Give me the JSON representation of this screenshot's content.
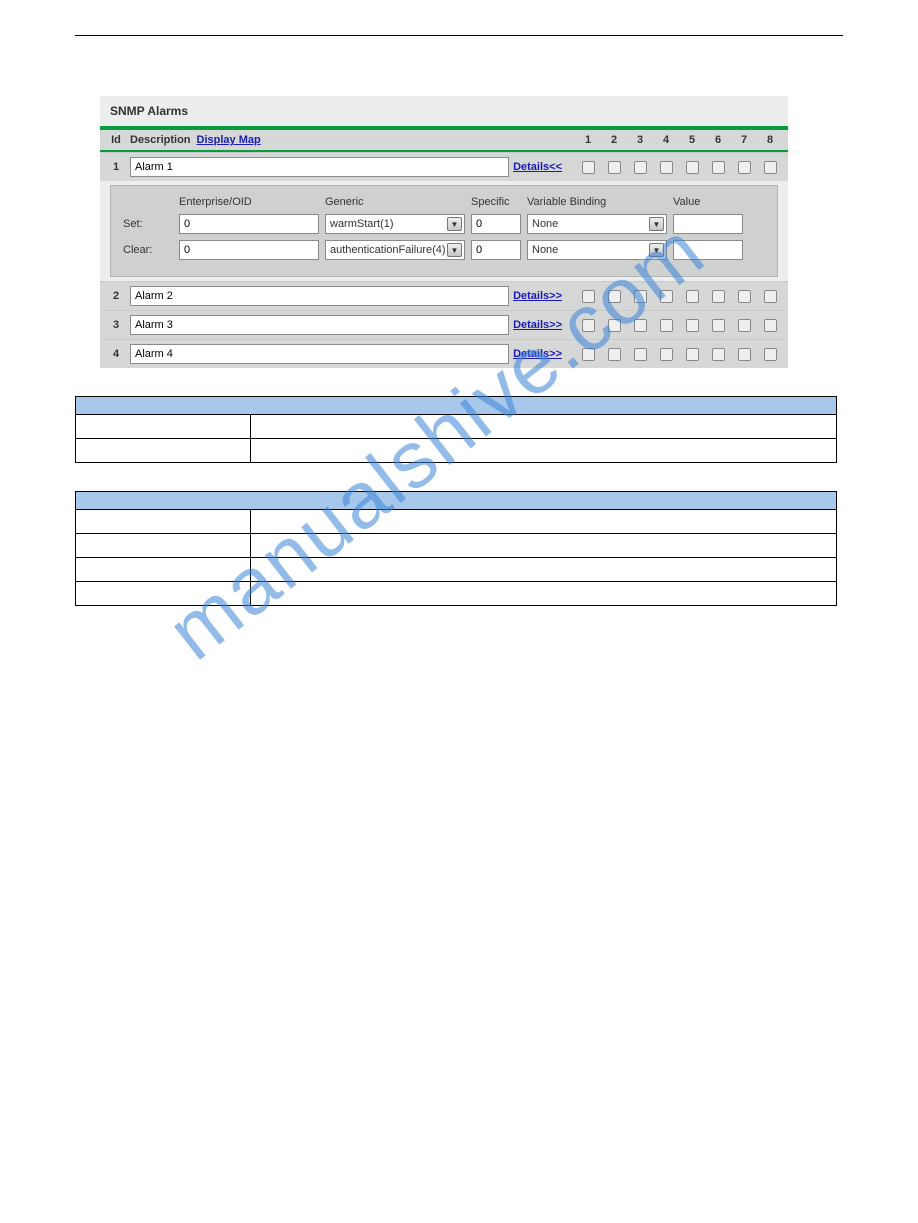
{
  "watermark": "manualshive.com",
  "panel": {
    "title": "SNMP Alarms",
    "header": {
      "id": "Id",
      "description": "Description",
      "display_map": "Display Map",
      "cols": [
        "1",
        "2",
        "3",
        "4",
        "5",
        "6",
        "7",
        "8"
      ]
    },
    "details": {
      "labels": {
        "enterprise": "Enterprise/OID",
        "generic": "Generic",
        "specific": "Specific",
        "varbind": "Variable Binding",
        "value": "Value",
        "set": "Set:",
        "clear": "Clear:"
      },
      "set": {
        "enterprise": "0",
        "generic": "warmStart(1)",
        "specific": "0",
        "varbind": "None",
        "value": ""
      },
      "clear": {
        "enterprise": "0",
        "generic": "authenticationFailure(4)",
        "specific": "0",
        "varbind": "None",
        "value": ""
      }
    },
    "alarms": [
      {
        "id": "1",
        "desc": "Alarm 1",
        "details_label": "Details<<",
        "expanded": true
      },
      {
        "id": "2",
        "desc": "Alarm 2",
        "details_label": "Details>>",
        "expanded": false
      },
      {
        "id": "3",
        "desc": "Alarm 3",
        "details_label": "Details>>",
        "expanded": false
      },
      {
        "id": "4",
        "desc": "Alarm 4",
        "details_label": "Details>>",
        "expanded": false
      }
    ]
  },
  "table1": {
    "header": "",
    "rows": [
      [
        "",
        ""
      ],
      [
        "",
        ""
      ]
    ]
  },
  "table2": {
    "header": "",
    "rows": [
      [
        "",
        ""
      ],
      [
        "",
        ""
      ],
      [
        "",
        ""
      ],
      [
        "",
        ""
      ]
    ]
  }
}
